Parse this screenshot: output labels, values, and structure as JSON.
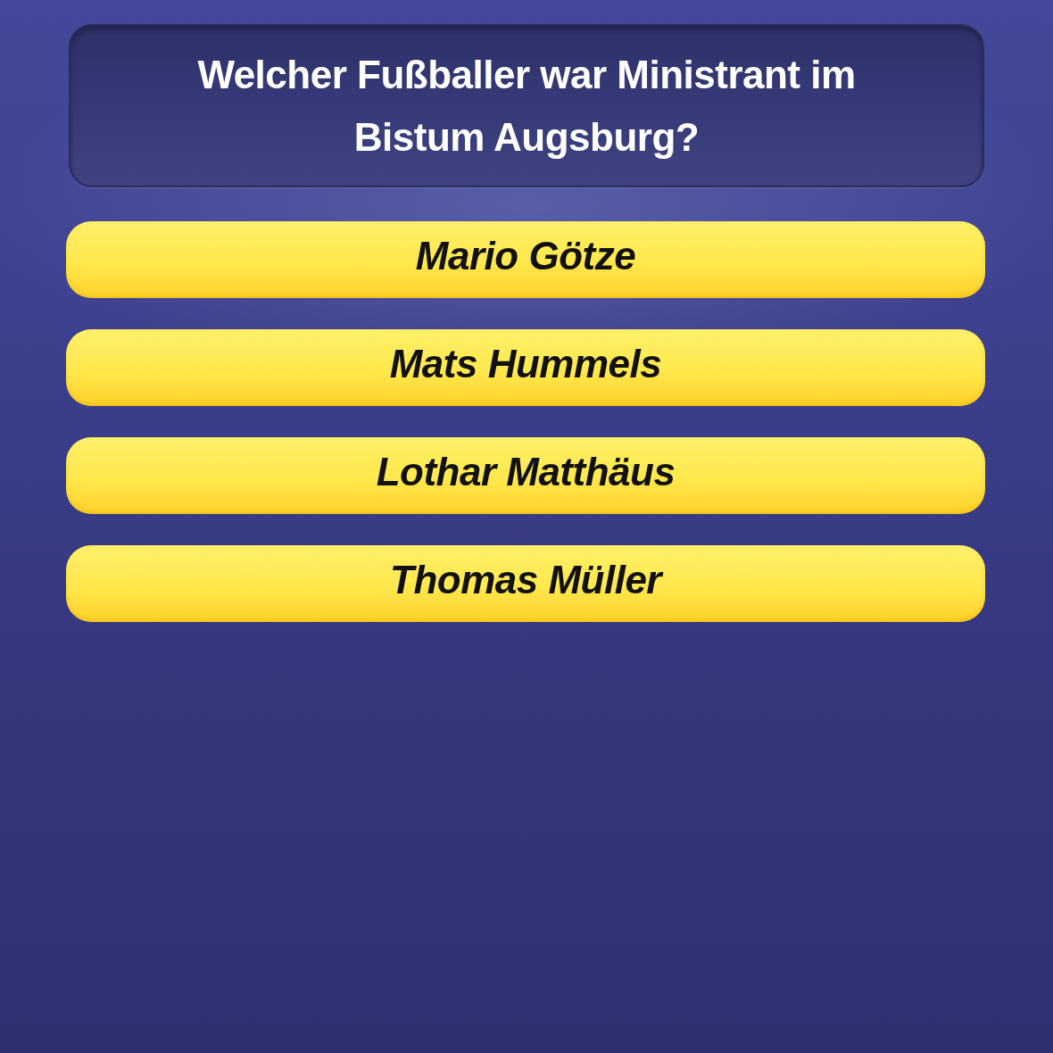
{
  "question": {
    "text": "Welcher Fußballer war Ministrant im Bistum Augsburg?"
  },
  "answers": [
    {
      "label": "Mario Götze"
    },
    {
      "label": "Mats Hummels"
    },
    {
      "label": "Lothar Matthäus"
    },
    {
      "label": "Thomas Müller"
    }
  ]
}
